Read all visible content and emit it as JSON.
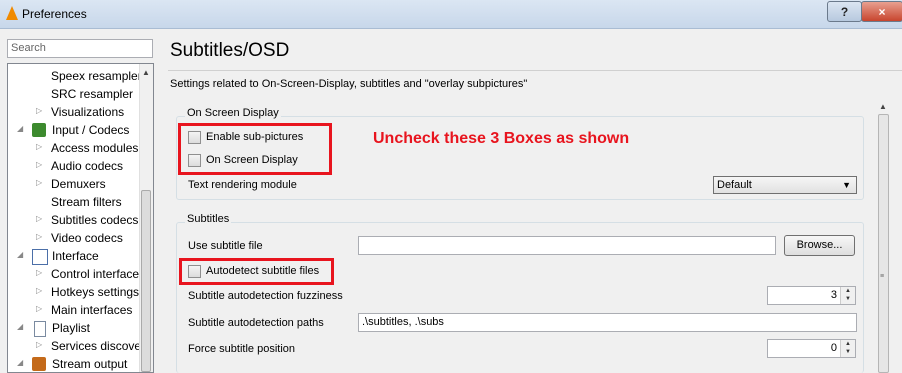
{
  "window": {
    "title": "Preferences",
    "help_label": "?",
    "close_label": "×"
  },
  "search": {
    "placeholder": "Search"
  },
  "tree": {
    "items": [
      {
        "label": "Speex resampler"
      },
      {
        "label": "SRC resampler"
      },
      {
        "label": "Visualizations"
      },
      {
        "label": "Input / Codecs"
      },
      {
        "label": "Access modules"
      },
      {
        "label": "Audio codecs"
      },
      {
        "label": "Demuxers"
      },
      {
        "label": "Stream filters"
      },
      {
        "label": "Subtitles codecs"
      },
      {
        "label": "Video codecs"
      },
      {
        "label": "Interface"
      },
      {
        "label": "Control interface"
      },
      {
        "label": "Hotkeys settings"
      },
      {
        "label": "Main interfaces"
      },
      {
        "label": "Playlist"
      },
      {
        "label": "Services discove"
      },
      {
        "label": "Stream output"
      }
    ]
  },
  "panel": {
    "title": "Subtitles/OSD",
    "description": "Settings related to On-Screen-Display, subtitles and \"overlay subpictures\"",
    "osd_group": {
      "title": "On Screen Display",
      "enable_subpictures": "Enable sub-pictures",
      "on_screen_display": "On Screen Display",
      "text_rendering_label": "Text rendering module",
      "text_rendering_value": "Default"
    },
    "subtitles_group": {
      "title": "Subtitles",
      "use_subtitle_file_label": "Use subtitle file",
      "use_subtitle_file_value": "",
      "browse_label": "Browse...",
      "autodetect_label": "Autodetect subtitle files",
      "fuzziness_label": "Subtitle autodetection fuzziness",
      "fuzziness_value": "3",
      "paths_label": "Subtitle autodetection paths",
      "paths_value": ".\\subtitles, .\\subs",
      "force_position_label": "Force subtitle position",
      "force_position_value": "0"
    }
  },
  "annotation": "Uncheck these 3 Boxes as shown",
  "colors": {
    "annotation_red": "#e8141e",
    "vlc_orange": "#f08a00"
  }
}
